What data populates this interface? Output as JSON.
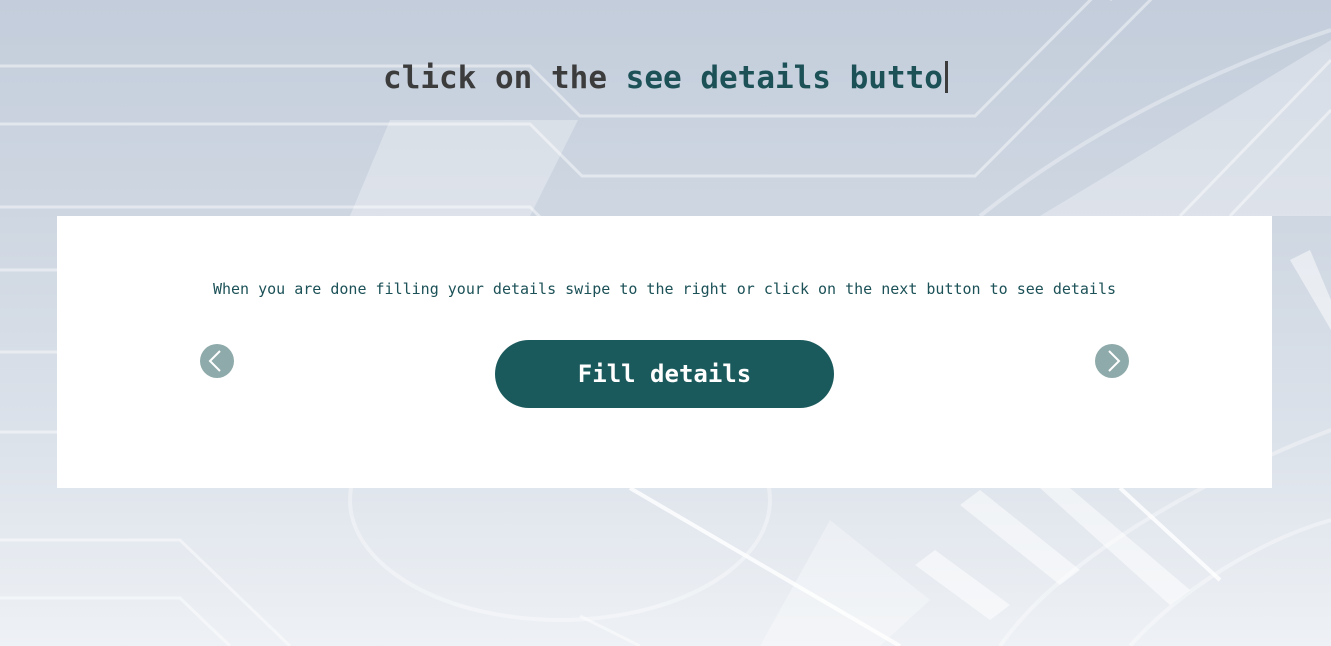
{
  "header": {
    "typed_prefix": "click on the ",
    "typed_accent": "see details butto"
  },
  "card": {
    "instruction": "When you are done filling your details swipe to the right or click on the next button to see details",
    "fill_button_label": "Fill details",
    "prev_icon": "chevron-left-icon",
    "next_icon": "chevron-right-icon"
  },
  "colors": {
    "accent": "#1b5157",
    "button": "#1b5a5c",
    "arrow": "#8faaaa",
    "card": "#ffffff"
  }
}
